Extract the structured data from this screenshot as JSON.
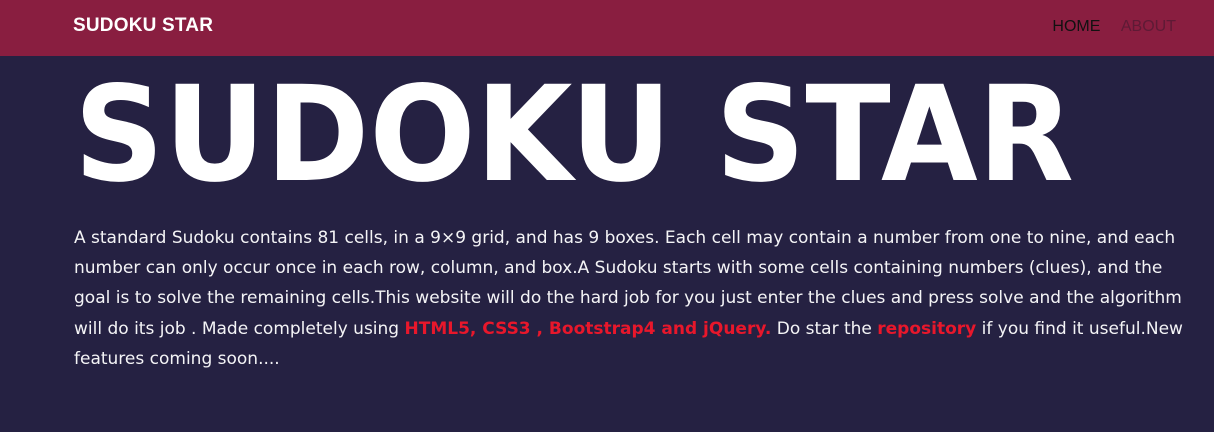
{
  "navbar": {
    "brand": "SUDOKU STAR",
    "links": [
      {
        "label": "HOME",
        "active": true
      },
      {
        "label": "ABOUT",
        "active": false
      }
    ],
    "background": "#891e40"
  },
  "hero": {
    "title": "SUDOKU STAR",
    "description": {
      "part1": "A standard Sudoku contains 81 cells, in a 9×9 grid, and has 9 boxes. Each cell may contain a number from one to nine, and each number can only occur once in each row, column, and box.A Sudoku starts with some cells containing numbers (clues), and the goal is to solve the remaining cells.This website will do the hard job for you just enter the clues and press solve and the algorithm will do its job . Made completely using ",
      "tech_link": "HTML5, CSS3 , Bootstrap4 and jQuery.",
      "part2": " Do star the ",
      "repo_link": "repository",
      "part3": " if you find it useful.New features coming soon...."
    },
    "link_color": "#e8172b"
  },
  "page_background": "#252142"
}
